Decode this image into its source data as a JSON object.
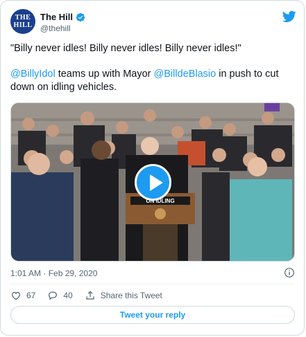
{
  "account": {
    "display_name": "The Hill",
    "handle": "@thehill",
    "avatar_lines": [
      "THE",
      "HILL"
    ]
  },
  "tweet": {
    "quote": "\"Billy never idles! Billy never idles! Billy never idles!\"",
    "mention_1": "@BillyIdol",
    "text_1": " teams up with Mayor ",
    "mention_2": "@BilldeBlasio",
    "text_2": " in push to cut down on idling vehicles."
  },
  "media": {
    "podium_sign": "ON IDLING",
    "icon": "play-icon"
  },
  "meta": {
    "timestamp": "1:01 AM · Feb 29, 2020"
  },
  "actions": {
    "likes": "67",
    "replies": "40",
    "share_label": "Share this Tweet"
  },
  "reply_button": {
    "label": "Tweet your reply"
  },
  "colors": {
    "accent": "#1d9bf0",
    "avatar_bg": "#1b3f8f",
    "like_icon": "#ec4c7a"
  }
}
